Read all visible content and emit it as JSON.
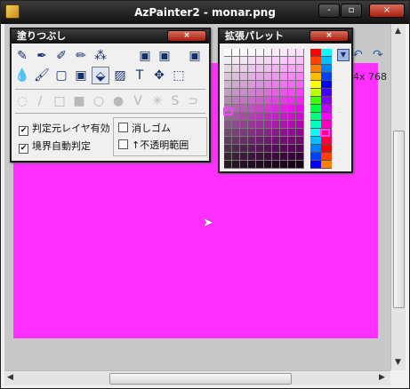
{
  "window": {
    "title": "AzPainter2 - monar.png",
    "minimize_label": "-",
    "maximize_label": "▫",
    "close_label": "×"
  },
  "toolbar": {
    "canvas_size": "4x 768",
    "undo_icon": "undo-icon",
    "redo_icon": "redo-icon"
  },
  "canvas": {
    "fill_color": "#ff30ff"
  },
  "fill_panel": {
    "title": "塗りつぶし",
    "close_label": "×",
    "options": [
      {
        "label": "判定元レイヤ有効",
        "checked": true
      },
      {
        "label": "境界自動判定",
        "checked": true
      },
      {
        "label": "消しゴム",
        "checked": false
      },
      {
        "label": "↑不透明範囲",
        "checked": false
      }
    ],
    "tools_row1": [
      "✎",
      "✒",
      "✐",
      "✏",
      "⁂",
      "▣",
      "▣",
      "▣"
    ],
    "tools_row2": [
      "💧",
      "🖌",
      "▢",
      "▣",
      "⬙",
      "▨",
      "T",
      "✥",
      "⬚"
    ],
    "tools_row3": [
      "◌",
      "/",
      "□",
      "■",
      "○",
      "●",
      "V",
      "✳",
      "S",
      "⊃"
    ]
  },
  "palette_panel": {
    "title": "拡張パレット",
    "close_label": "×",
    "dropdown_icon": "chevron-down-icon"
  }
}
